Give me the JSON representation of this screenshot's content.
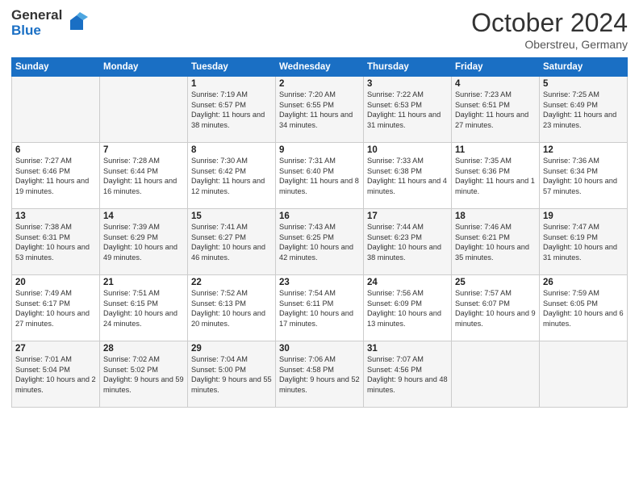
{
  "header": {
    "logo_general": "General",
    "logo_blue": "Blue",
    "month": "October 2024",
    "location": "Oberstreu, Germany"
  },
  "weekdays": [
    "Sunday",
    "Monday",
    "Tuesday",
    "Wednesday",
    "Thursday",
    "Friday",
    "Saturday"
  ],
  "rows": [
    [
      {
        "day": "",
        "info": ""
      },
      {
        "day": "",
        "info": ""
      },
      {
        "day": "1",
        "info": "Sunrise: 7:19 AM\nSunset: 6:57 PM\nDaylight: 11 hours\nand 38 minutes."
      },
      {
        "day": "2",
        "info": "Sunrise: 7:20 AM\nSunset: 6:55 PM\nDaylight: 11 hours\nand 34 minutes."
      },
      {
        "day": "3",
        "info": "Sunrise: 7:22 AM\nSunset: 6:53 PM\nDaylight: 11 hours\nand 31 minutes."
      },
      {
        "day": "4",
        "info": "Sunrise: 7:23 AM\nSunset: 6:51 PM\nDaylight: 11 hours\nand 27 minutes."
      },
      {
        "day": "5",
        "info": "Sunrise: 7:25 AM\nSunset: 6:49 PM\nDaylight: 11 hours\nand 23 minutes."
      }
    ],
    [
      {
        "day": "6",
        "info": "Sunrise: 7:27 AM\nSunset: 6:46 PM\nDaylight: 11 hours\nand 19 minutes."
      },
      {
        "day": "7",
        "info": "Sunrise: 7:28 AM\nSunset: 6:44 PM\nDaylight: 11 hours\nand 16 minutes."
      },
      {
        "day": "8",
        "info": "Sunrise: 7:30 AM\nSunset: 6:42 PM\nDaylight: 11 hours\nand 12 minutes."
      },
      {
        "day": "9",
        "info": "Sunrise: 7:31 AM\nSunset: 6:40 PM\nDaylight: 11 hours\nand 8 minutes."
      },
      {
        "day": "10",
        "info": "Sunrise: 7:33 AM\nSunset: 6:38 PM\nDaylight: 11 hours\nand 4 minutes."
      },
      {
        "day": "11",
        "info": "Sunrise: 7:35 AM\nSunset: 6:36 PM\nDaylight: 11 hours\nand 1 minute."
      },
      {
        "day": "12",
        "info": "Sunrise: 7:36 AM\nSunset: 6:34 PM\nDaylight: 10 hours\nand 57 minutes."
      }
    ],
    [
      {
        "day": "13",
        "info": "Sunrise: 7:38 AM\nSunset: 6:31 PM\nDaylight: 10 hours\nand 53 minutes."
      },
      {
        "day": "14",
        "info": "Sunrise: 7:39 AM\nSunset: 6:29 PM\nDaylight: 10 hours\nand 49 minutes."
      },
      {
        "day": "15",
        "info": "Sunrise: 7:41 AM\nSunset: 6:27 PM\nDaylight: 10 hours\nand 46 minutes."
      },
      {
        "day": "16",
        "info": "Sunrise: 7:43 AM\nSunset: 6:25 PM\nDaylight: 10 hours\nand 42 minutes."
      },
      {
        "day": "17",
        "info": "Sunrise: 7:44 AM\nSunset: 6:23 PM\nDaylight: 10 hours\nand 38 minutes."
      },
      {
        "day": "18",
        "info": "Sunrise: 7:46 AM\nSunset: 6:21 PM\nDaylight: 10 hours\nand 35 minutes."
      },
      {
        "day": "19",
        "info": "Sunrise: 7:47 AM\nSunset: 6:19 PM\nDaylight: 10 hours\nand 31 minutes."
      }
    ],
    [
      {
        "day": "20",
        "info": "Sunrise: 7:49 AM\nSunset: 6:17 PM\nDaylight: 10 hours\nand 27 minutes."
      },
      {
        "day": "21",
        "info": "Sunrise: 7:51 AM\nSunset: 6:15 PM\nDaylight: 10 hours\nand 24 minutes."
      },
      {
        "day": "22",
        "info": "Sunrise: 7:52 AM\nSunset: 6:13 PM\nDaylight: 10 hours\nand 20 minutes."
      },
      {
        "day": "23",
        "info": "Sunrise: 7:54 AM\nSunset: 6:11 PM\nDaylight: 10 hours\nand 17 minutes."
      },
      {
        "day": "24",
        "info": "Sunrise: 7:56 AM\nSunset: 6:09 PM\nDaylight: 10 hours\nand 13 minutes."
      },
      {
        "day": "25",
        "info": "Sunrise: 7:57 AM\nSunset: 6:07 PM\nDaylight: 10 hours\nand 9 minutes."
      },
      {
        "day": "26",
        "info": "Sunrise: 7:59 AM\nSunset: 6:05 PM\nDaylight: 10 hours\nand 6 minutes."
      }
    ],
    [
      {
        "day": "27",
        "info": "Sunrise: 7:01 AM\nSunset: 5:04 PM\nDaylight: 10 hours\nand 2 minutes."
      },
      {
        "day": "28",
        "info": "Sunrise: 7:02 AM\nSunset: 5:02 PM\nDaylight: 9 hours\nand 59 minutes."
      },
      {
        "day": "29",
        "info": "Sunrise: 7:04 AM\nSunset: 5:00 PM\nDaylight: 9 hours\nand 55 minutes."
      },
      {
        "day": "30",
        "info": "Sunrise: 7:06 AM\nSunset: 4:58 PM\nDaylight: 9 hours\nand 52 minutes."
      },
      {
        "day": "31",
        "info": "Sunrise: 7:07 AM\nSunset: 4:56 PM\nDaylight: 9 hours\nand 48 minutes."
      },
      {
        "day": "",
        "info": ""
      },
      {
        "day": "",
        "info": ""
      }
    ]
  ]
}
